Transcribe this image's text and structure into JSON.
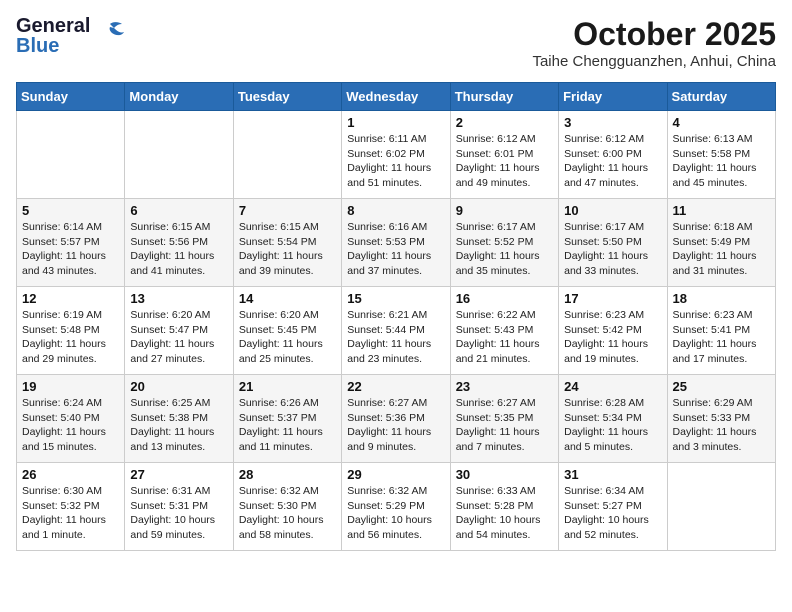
{
  "header": {
    "logo_general": "General",
    "logo_blue": "Blue",
    "month": "October 2025",
    "location": "Taihe Chengguanzhen, Anhui, China"
  },
  "weekdays": [
    "Sunday",
    "Monday",
    "Tuesday",
    "Wednesday",
    "Thursday",
    "Friday",
    "Saturday"
  ],
  "weeks": [
    [
      {
        "day": "",
        "content": ""
      },
      {
        "day": "",
        "content": ""
      },
      {
        "day": "",
        "content": ""
      },
      {
        "day": "1",
        "content": "Sunrise: 6:11 AM\nSunset: 6:02 PM\nDaylight: 11 hours\nand 51 minutes."
      },
      {
        "day": "2",
        "content": "Sunrise: 6:12 AM\nSunset: 6:01 PM\nDaylight: 11 hours\nand 49 minutes."
      },
      {
        "day": "3",
        "content": "Sunrise: 6:12 AM\nSunset: 6:00 PM\nDaylight: 11 hours\nand 47 minutes."
      },
      {
        "day": "4",
        "content": "Sunrise: 6:13 AM\nSunset: 5:58 PM\nDaylight: 11 hours\nand 45 minutes."
      }
    ],
    [
      {
        "day": "5",
        "content": "Sunrise: 6:14 AM\nSunset: 5:57 PM\nDaylight: 11 hours\nand 43 minutes."
      },
      {
        "day": "6",
        "content": "Sunrise: 6:15 AM\nSunset: 5:56 PM\nDaylight: 11 hours\nand 41 minutes."
      },
      {
        "day": "7",
        "content": "Sunrise: 6:15 AM\nSunset: 5:54 PM\nDaylight: 11 hours\nand 39 minutes."
      },
      {
        "day": "8",
        "content": "Sunrise: 6:16 AM\nSunset: 5:53 PM\nDaylight: 11 hours\nand 37 minutes."
      },
      {
        "day": "9",
        "content": "Sunrise: 6:17 AM\nSunset: 5:52 PM\nDaylight: 11 hours\nand 35 minutes."
      },
      {
        "day": "10",
        "content": "Sunrise: 6:17 AM\nSunset: 5:50 PM\nDaylight: 11 hours\nand 33 minutes."
      },
      {
        "day": "11",
        "content": "Sunrise: 6:18 AM\nSunset: 5:49 PM\nDaylight: 11 hours\nand 31 minutes."
      }
    ],
    [
      {
        "day": "12",
        "content": "Sunrise: 6:19 AM\nSunset: 5:48 PM\nDaylight: 11 hours\nand 29 minutes."
      },
      {
        "day": "13",
        "content": "Sunrise: 6:20 AM\nSunset: 5:47 PM\nDaylight: 11 hours\nand 27 minutes."
      },
      {
        "day": "14",
        "content": "Sunrise: 6:20 AM\nSunset: 5:45 PM\nDaylight: 11 hours\nand 25 minutes."
      },
      {
        "day": "15",
        "content": "Sunrise: 6:21 AM\nSunset: 5:44 PM\nDaylight: 11 hours\nand 23 minutes."
      },
      {
        "day": "16",
        "content": "Sunrise: 6:22 AM\nSunset: 5:43 PM\nDaylight: 11 hours\nand 21 minutes."
      },
      {
        "day": "17",
        "content": "Sunrise: 6:23 AM\nSunset: 5:42 PM\nDaylight: 11 hours\nand 19 minutes."
      },
      {
        "day": "18",
        "content": "Sunrise: 6:23 AM\nSunset: 5:41 PM\nDaylight: 11 hours\nand 17 minutes."
      }
    ],
    [
      {
        "day": "19",
        "content": "Sunrise: 6:24 AM\nSunset: 5:40 PM\nDaylight: 11 hours\nand 15 minutes."
      },
      {
        "day": "20",
        "content": "Sunrise: 6:25 AM\nSunset: 5:38 PM\nDaylight: 11 hours\nand 13 minutes."
      },
      {
        "day": "21",
        "content": "Sunrise: 6:26 AM\nSunset: 5:37 PM\nDaylight: 11 hours\nand 11 minutes."
      },
      {
        "day": "22",
        "content": "Sunrise: 6:27 AM\nSunset: 5:36 PM\nDaylight: 11 hours\nand 9 minutes."
      },
      {
        "day": "23",
        "content": "Sunrise: 6:27 AM\nSunset: 5:35 PM\nDaylight: 11 hours\nand 7 minutes."
      },
      {
        "day": "24",
        "content": "Sunrise: 6:28 AM\nSunset: 5:34 PM\nDaylight: 11 hours\nand 5 minutes."
      },
      {
        "day": "25",
        "content": "Sunrise: 6:29 AM\nSunset: 5:33 PM\nDaylight: 11 hours\nand 3 minutes."
      }
    ],
    [
      {
        "day": "26",
        "content": "Sunrise: 6:30 AM\nSunset: 5:32 PM\nDaylight: 11 hours\nand 1 minute."
      },
      {
        "day": "27",
        "content": "Sunrise: 6:31 AM\nSunset: 5:31 PM\nDaylight: 10 hours\nand 59 minutes."
      },
      {
        "day": "28",
        "content": "Sunrise: 6:32 AM\nSunset: 5:30 PM\nDaylight: 10 hours\nand 58 minutes."
      },
      {
        "day": "29",
        "content": "Sunrise: 6:32 AM\nSunset: 5:29 PM\nDaylight: 10 hours\nand 56 minutes."
      },
      {
        "day": "30",
        "content": "Sunrise: 6:33 AM\nSunset: 5:28 PM\nDaylight: 10 hours\nand 54 minutes."
      },
      {
        "day": "31",
        "content": "Sunrise: 6:34 AM\nSunset: 5:27 PM\nDaylight: 10 hours\nand 52 minutes."
      },
      {
        "day": "",
        "content": ""
      }
    ]
  ]
}
